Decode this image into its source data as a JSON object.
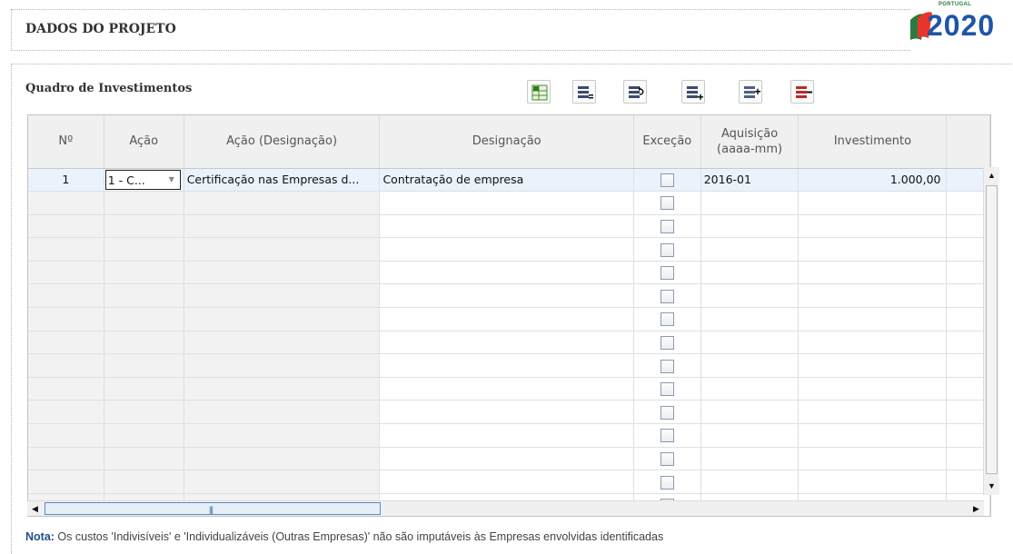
{
  "header": {
    "title": "DADOS DO PROJETO"
  },
  "logo": {
    "small": "PORTUGAL",
    "big": "2020",
    "colors": [
      "#2a7c3e",
      "#e8342d",
      "#1f55a6"
    ]
  },
  "section": {
    "title": "Quadro de Investimentos"
  },
  "toolbar": {
    "buttons": [
      {
        "name": "export-excel-button",
        "icon": "excel-icon"
      },
      {
        "name": "list-edit-button",
        "icon": "list-equals-icon"
      },
      {
        "name": "list-undo-button",
        "icon": "list-undo-icon"
      },
      {
        "name": "list-add-button",
        "icon": "list-add-icon"
      },
      {
        "name": "list-add-alt-button",
        "icon": "list-add-alt-icon"
      },
      {
        "name": "list-remove-button",
        "icon": "list-remove-icon"
      }
    ]
  },
  "grid": {
    "columns": [
      "Nº",
      "Ação",
      "Ação (Designação)",
      "Designação",
      "Exceção",
      "Aquisição (aaaa-mm)",
      "Investimento"
    ],
    "rows": [
      {
        "n": "1",
        "acao": "1 - C...",
        "acao_designacao": "Certificação nas Empresas d...",
        "designacao": "Contratação de empresa",
        "excecao": false,
        "aquisicao": "2016-01",
        "investimento": "1.000,00"
      }
    ],
    "empty_rows": 14
  },
  "note": {
    "label": "Nota:",
    "text": " Os custos 'Indivisíveis' e 'Individualizáveis (Outras Empresas)' não são imputáveis às Empresas envolvidas identificadas"
  }
}
